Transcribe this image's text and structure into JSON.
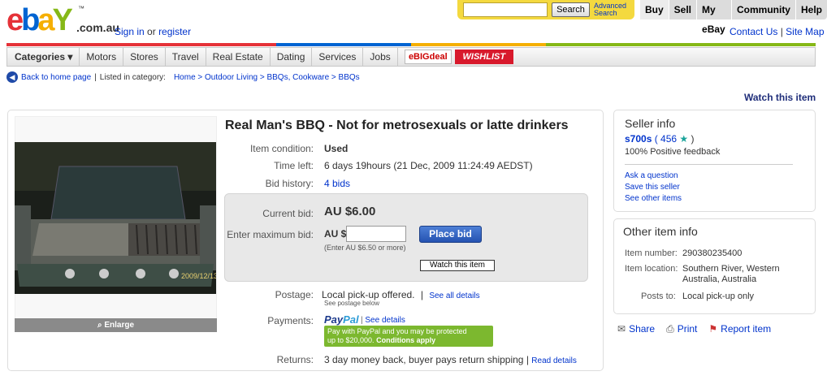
{
  "header": {
    "logo": {
      "e": "e",
      "b": "b",
      "a": "a",
      "y": "Y",
      "tm": "™",
      "domain": ".com.au"
    },
    "sign_in_link": "Sign in",
    "sign_in_or": "or",
    "register_link": "register",
    "search_button": "Search",
    "advanced_search": "Advanced Search",
    "topnav": [
      "Buy",
      "Sell",
      "My eBay",
      "Community",
      "Help"
    ],
    "contact_us": "Contact Us",
    "site_map": "Site Map",
    "color_bar": [
      "#e53238",
      "#e53238",
      "#0064d2",
      "#f5af02",
      "#86b817",
      "#86b817"
    ]
  },
  "categories": [
    "Categories ▾",
    "Motors",
    "Stores",
    "Travel",
    "Real Estate",
    "Dating",
    "Services",
    "Jobs"
  ],
  "promos": {
    "bigdeal": "eBIGdeal",
    "wishlist": "WISHLIST"
  },
  "breadcrumb": {
    "back": "Back to home page",
    "sep": "|",
    "listed_in": "Listed in category:",
    "path": "Home > Outdoor Living > BBQs, Cookware > BBQs"
  },
  "watch_top": "Watch this item",
  "listing": {
    "title": "Real Man's BBQ - Not for metrosexuals or latte drinkers",
    "photo_date": "2009/12/13",
    "enlarge": "Enlarge",
    "condition_label": "Item condition:",
    "condition": "Used",
    "time_left_label": "Time left:",
    "time_left": "6 days 19hours (21 Dec, 2009 11:24:49 AEDST)",
    "bid_history_label": "Bid history:",
    "bid_history": "4 bids",
    "current_bid_label": "Current bid:",
    "current_bid": "AU $6.00",
    "max_bid_label": "Enter maximum bid:",
    "currency": "AU $",
    "max_bid_value": "",
    "place_bid": "Place bid",
    "bid_hint": "(Enter AU $6.50 or more)",
    "watch_button": "Watch this item",
    "postage_label": "Postage:",
    "postage": "Local pick-up offered.",
    "see_all_details": "See all details",
    "postage_note": "See postage below",
    "payments_label": "Payments:",
    "paypal_pay": "Pay",
    "paypal_pal": "Pal",
    "see_details": "See details",
    "paypal_badge_line1": "Pay with PayPal and you may be protected",
    "paypal_badge_line2": "up to $20,000.",
    "conditions_apply": "Conditions apply",
    "returns_label": "Returns:",
    "returns": "3 day money back, buyer pays return shipping",
    "read_details": "Read details"
  },
  "seller": {
    "heading": "Seller info",
    "name": "s700s",
    "feedback_score": "( 456",
    "close_paren": ")",
    "positive": "100% Positive feedback",
    "ask_question": "Ask a question",
    "save_seller": "Save this seller",
    "other_items": "See other items"
  },
  "other_info": {
    "heading": "Other item info",
    "item_number_label": "Item number:",
    "item_number": "290380235400",
    "location_label": "Item location:",
    "location_line1": "Southern River, Western",
    "location_line2": "Australia, Australia",
    "posts_to_label": "Posts to:",
    "posts_to": "Local pick-up only"
  },
  "actions": {
    "share": "Share",
    "print": "Print",
    "report": "Report item"
  }
}
